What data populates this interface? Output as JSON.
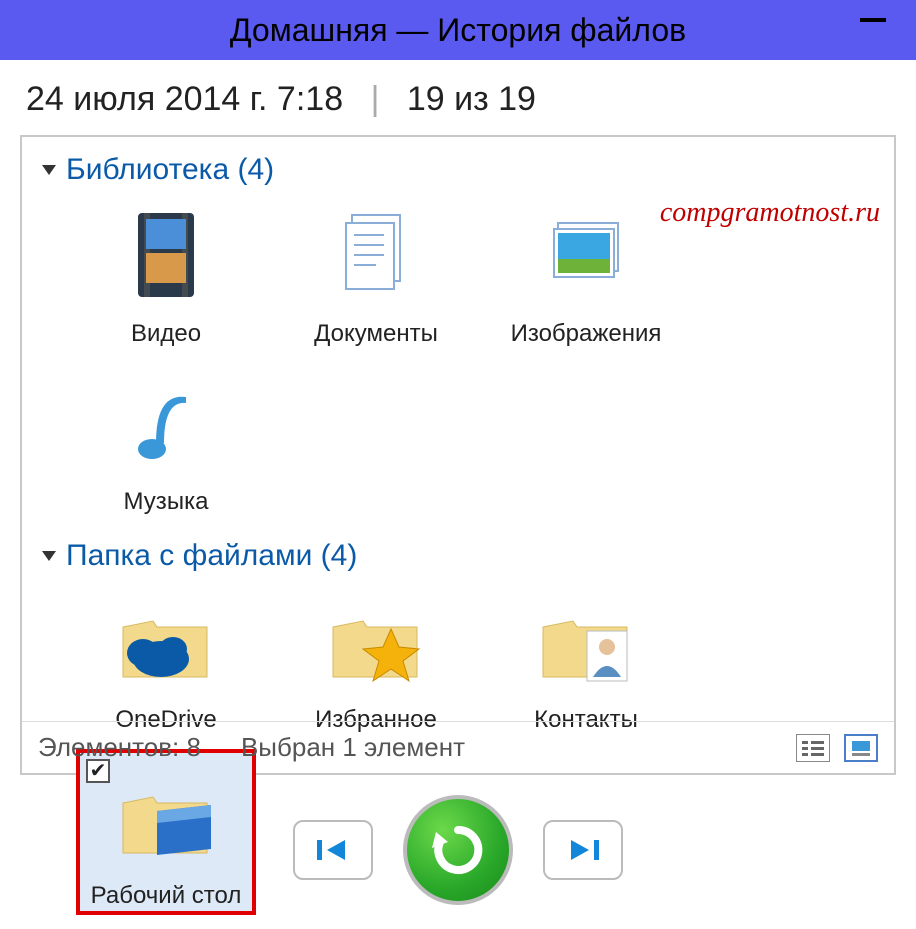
{
  "window": {
    "title": "Домашняя — История файлов"
  },
  "header": {
    "datetime": "24 июля 2014 г. 7:18",
    "position": "19 из 19"
  },
  "watermark": "compgramotnost.ru",
  "groups": [
    {
      "title": "Библиотека (4)",
      "items": [
        {
          "label": "Видео",
          "icon": "videos"
        },
        {
          "label": "Документы",
          "icon": "documents"
        },
        {
          "label": "Изображения",
          "icon": "pictures"
        },
        {
          "label": "Музыка",
          "icon": "music"
        }
      ]
    },
    {
      "title": "Папка с файлами (4)",
      "items": [
        {
          "label": "OneDrive",
          "icon": "onedrive"
        },
        {
          "label": "Избранное",
          "icon": "favorites"
        },
        {
          "label": "Контакты",
          "icon": "contacts"
        },
        {
          "label": "Рабочий стол",
          "icon": "desktop",
          "selected": true,
          "checked": true
        }
      ]
    }
  ],
  "status": {
    "count_label": "Элементов: 8",
    "selection_label": "Выбран 1 элемент"
  },
  "controls": {
    "prev": "previous-version",
    "restore": "restore",
    "next": "next-version"
  }
}
